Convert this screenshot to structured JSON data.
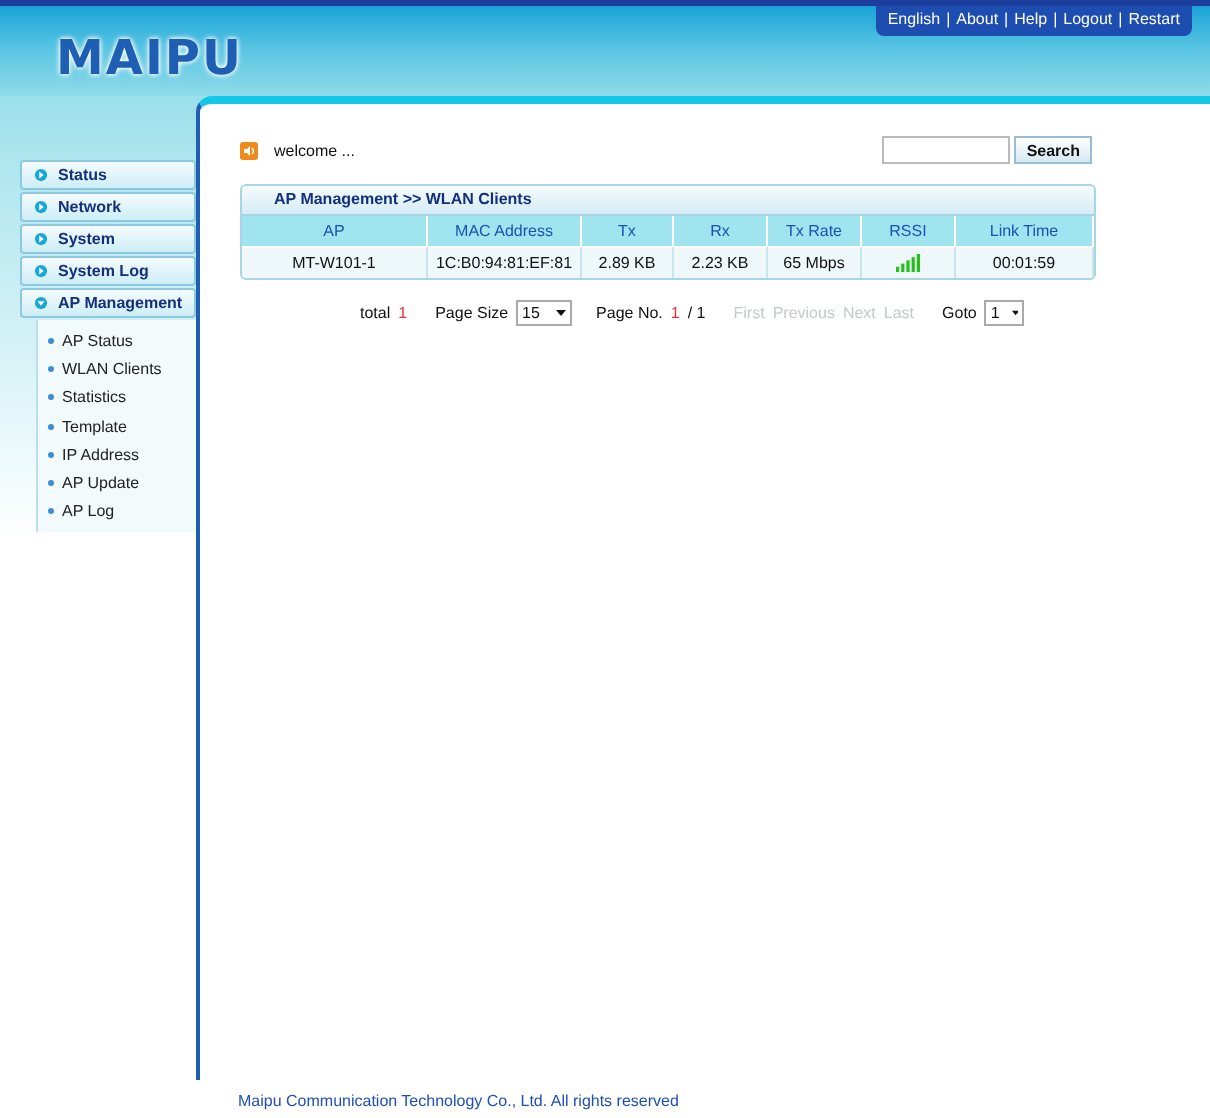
{
  "header": {
    "logo": "MAIPU",
    "links": [
      "English",
      "About",
      "Help",
      "Logout",
      "Restart"
    ],
    "separator": "|"
  },
  "sidebar": {
    "items": [
      {
        "label": "Status",
        "expanded": false
      },
      {
        "label": "Network",
        "expanded": false
      },
      {
        "label": "System",
        "expanded": false
      },
      {
        "label": "System Log",
        "expanded": false
      },
      {
        "label": "AP Management",
        "expanded": true,
        "children": [
          {
            "label": "AP Status"
          },
          {
            "label": "WLAN Clients"
          },
          {
            "label": "Statistics"
          },
          {
            "label": "Template"
          },
          {
            "label": "IP Address"
          },
          {
            "label": "AP Update"
          },
          {
            "label": "AP Log"
          }
        ]
      }
    ]
  },
  "welcome": "welcome ...",
  "search": {
    "button": "Search"
  },
  "table": {
    "title": "AP Management >> WLAN Clients",
    "columns": [
      "AP",
      "MAC Address",
      "Tx",
      "Rx",
      "Tx Rate",
      "RSSI",
      "Link Time"
    ],
    "rows": [
      {
        "ap": "MT-W101-1",
        "mac": "1C:B0:94:81:EF:81",
        "tx": "2.89 KB",
        "rx": "2.23 KB",
        "tx_rate": "65 Mbps",
        "link_time": "00:01:59"
      }
    ]
  },
  "pager": {
    "total_label": "total",
    "total": "1",
    "page_size_label": "Page Size",
    "page_size": "15",
    "page_no_label": "Page No.",
    "page_current": "1",
    "page_count": "/ 1",
    "links": [
      {
        "label": "First",
        "disabled": true
      },
      {
        "label": "Previous",
        "disabled": true
      },
      {
        "label": "Next",
        "disabled": true
      },
      {
        "label": "Last",
        "disabled": true
      }
    ],
    "goto_label": "Goto",
    "goto": "1"
  },
  "footer": "Maipu Communication Technology Co., Ltd. All rights reserved"
}
